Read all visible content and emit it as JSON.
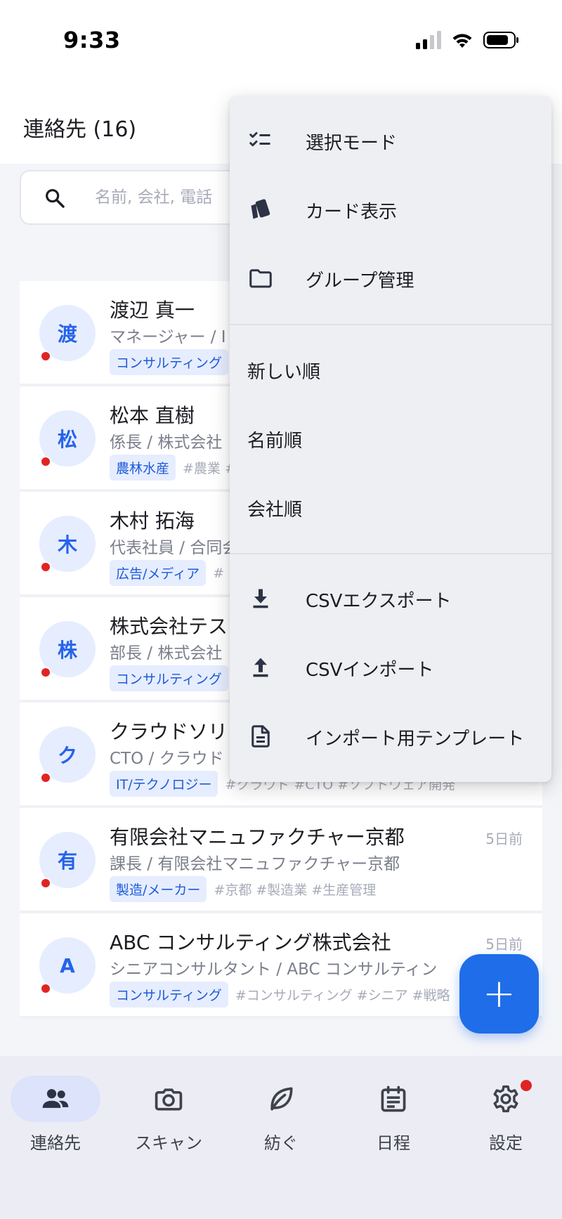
{
  "status_bar": {
    "time": "9:33"
  },
  "header": {
    "title": "連絡先 (16)"
  },
  "search": {
    "placeholder": "名前, 会社, 電話"
  },
  "contacts": [
    {
      "initial": "渡",
      "name": "渡辺 真一",
      "role": "マネージャー / I",
      "industry": "コンサルティング",
      "hashtags": "",
      "time": ""
    },
    {
      "initial": "松",
      "name": "松本 直樹",
      "role": "係長 / 株式会社",
      "industry": "農林水産",
      "hashtags": "#農業 #",
      "time": ""
    },
    {
      "initial": "木",
      "name": "木村 拓海",
      "role": "代表社員 / 合同会",
      "industry": "広告/メディア",
      "hashtags": "#",
      "time": ""
    },
    {
      "initial": "株",
      "name": "株式会社テス",
      "role": "部長 / 株式会社",
      "industry": "コンサルティング",
      "hashtags": "",
      "time": ""
    },
    {
      "initial": "ク",
      "name": "クラウドソリ",
      "role": "CTO / クラウド",
      "industry": "IT/テクノロジー",
      "hashtags": "#クラウド #CTO #ソフトウェア開発",
      "time": ""
    },
    {
      "initial": "有",
      "name": "有限会社マニュファクチャー京都",
      "role": "課長 / 有限会社マニュファクチャー京都",
      "industry": "製造/メーカー",
      "hashtags": "#京都 #製造業 #生産管理",
      "time": "5日前"
    },
    {
      "initial": "A",
      "name": "ABC コンサルティング株式会社",
      "role": "シニアコンサルタント / ABC コンサルティン",
      "industry": "コンサルティング",
      "hashtags": "#コンサルティング #シニア #戦略",
      "time": "5日前"
    }
  ],
  "menu": {
    "items": [
      {
        "label": "選択モード",
        "icon": "checklist-icon"
      },
      {
        "label": "カード表示",
        "icon": "cards-icon"
      },
      {
        "label": "グループ管理",
        "icon": "folder-icon"
      }
    ],
    "sort": [
      "新しい順",
      "名前順",
      "会社順"
    ],
    "csv": [
      {
        "label": "CSVエクスポート",
        "icon": "download-icon"
      },
      {
        "label": "CSVインポート",
        "icon": "upload-icon"
      },
      {
        "label": "インポート用テンプレート",
        "icon": "document-icon"
      }
    ]
  },
  "fab": {
    "label": "+"
  },
  "bottom_nav": [
    {
      "label": "連絡先",
      "icon": "people-icon",
      "active": true
    },
    {
      "label": "スキャン",
      "icon": "camera-icon",
      "active": false
    },
    {
      "label": "紡ぐ",
      "icon": "leaf-icon",
      "active": false
    },
    {
      "label": "日程",
      "icon": "calendar-icon",
      "active": false
    },
    {
      "label": "設定",
      "icon": "gear-icon",
      "active": false,
      "badge": true
    }
  ],
  "colors": {
    "accent": "#1f6de8",
    "badge_bg": "#e6edff",
    "unread": "#e02424"
  }
}
